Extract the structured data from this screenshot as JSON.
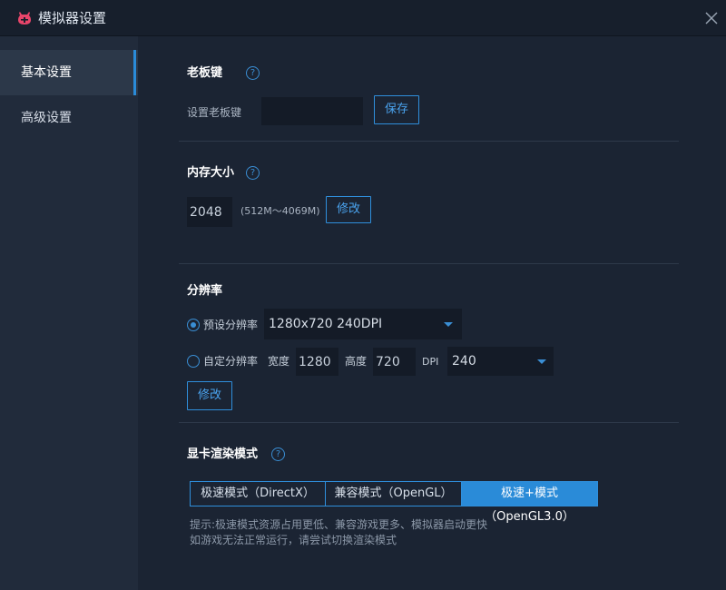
{
  "window": {
    "title": "模拟器设置",
    "icon": "app-logo-icon",
    "close_icon": "close-icon"
  },
  "sidebar": {
    "items": [
      {
        "label": "基本设置",
        "active": true
      },
      {
        "label": "高级设置",
        "active": false
      }
    ]
  },
  "boss_key": {
    "title": "老板键",
    "help": "?",
    "field_label": "设置老板键",
    "value": "",
    "save_label": "保存"
  },
  "memory": {
    "title": "内存大小",
    "help": "?",
    "value": "2048",
    "range": "(512M～4069M)",
    "modify_label": "修改"
  },
  "resolution": {
    "title": "分辨率",
    "preset_label": "预设分辨率",
    "preset_selected": true,
    "preset_value": "1280x720 240DPI",
    "custom_label": "自定分辨率",
    "width_label": "宽度",
    "width_value": "1280",
    "height_label": "高度",
    "height_value": "720",
    "dpi_label": "DPI",
    "dpi_value": "240",
    "modify_label": "修改"
  },
  "render": {
    "title": "显卡渲染模式",
    "help": "?",
    "modes": [
      {
        "label": "极速模式（DirectX）",
        "active": false
      },
      {
        "label": "兼容模式（OpenGL）",
        "active": false
      },
      {
        "label": "极速+模式（OpenGL3.0）",
        "active": true
      }
    ],
    "hint_line1": "提示:极速模式资源占用更低、兼容游戏更多、模拟器启动更快",
    "hint_line2": "如游戏无法正常运行，请尝试切换渲染模式"
  },
  "colors": {
    "accent": "#2a8bd8",
    "background": "#1b2433",
    "sidebar": "#212b3b",
    "logo": "#e8456a"
  }
}
